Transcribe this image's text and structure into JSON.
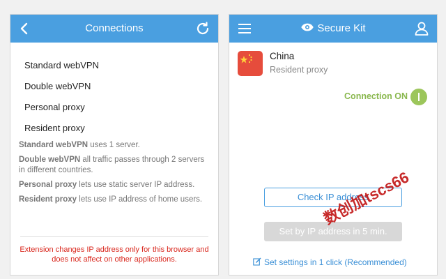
{
  "left": {
    "title": "Connections",
    "items": [
      {
        "label": "Standard webVPN"
      },
      {
        "label": "Double webVPN"
      },
      {
        "label": "Personal proxy"
      },
      {
        "label": "Resident proxy"
      }
    ],
    "descriptions": [
      {
        "term": "Standard webVPN",
        "text": " uses 1 server."
      },
      {
        "term": "Double webVPN",
        "text": " all traffic passes through 2 servers in different countries."
      },
      {
        "term": "Personal proxy",
        "text": " lets use static server IP address."
      },
      {
        "term": "Resident proxy",
        "text": " lets use IP address of home users."
      }
    ],
    "warning": "Extension changes IP address only for this browser and does not affect on other applications."
  },
  "right": {
    "title": "Secure Kit",
    "country": "China",
    "proxy_type": "Resident proxy",
    "status": "Connection ON",
    "check_ip_label": "Check IP address",
    "set_ip_label": "Set by IP address in 5 min.",
    "settings_link": "Set settings in 1 click (Recommended)"
  },
  "watermark": "数创加tscs66",
  "colors": {
    "header_blue": "#4a9fe0",
    "status_green": "#8ab84f",
    "warning_red": "#d9261c",
    "flag_red": "#e64c3c"
  },
  "icons": {
    "back": "chevron-left-icon",
    "refresh": "refresh-icon",
    "menu": "hamburger-menu-icon",
    "eye": "eye-icon",
    "user": "user-icon",
    "edit": "edit-icon"
  }
}
